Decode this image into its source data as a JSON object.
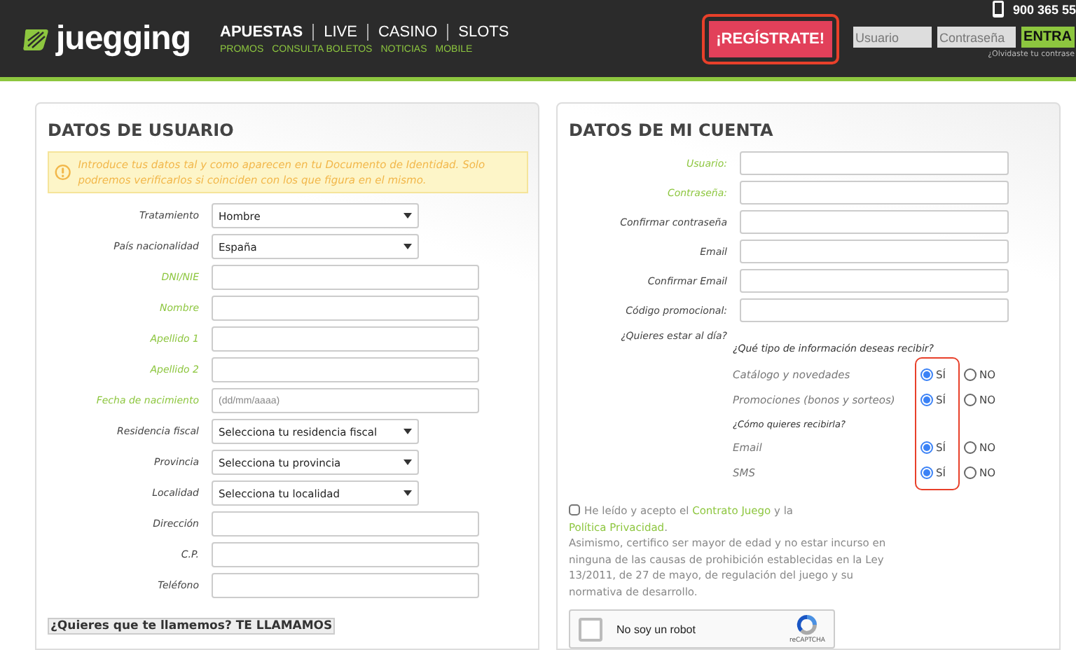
{
  "header": {
    "logo": "juegging",
    "nav_main": [
      {
        "label": "APUESTAS",
        "selected": true
      },
      {
        "label": "LIVE",
        "selected": false
      },
      {
        "label": "CASINO",
        "selected": false
      },
      {
        "label": "SLOTS",
        "selected": false
      }
    ],
    "nav_sub": [
      "PROMOS",
      "CONSULTA BOLETOS",
      "NOTICIAS",
      "MOBILE"
    ],
    "phone": "900 365 55",
    "register_button": {
      "label": "¡REGÍSTRATE!",
      "highlighted": true
    },
    "login": {
      "username_placeholder": "Usuario",
      "password_placeholder": "Contraseña",
      "submit": "ENTRA",
      "forgot": "¿Olvidaste tu contrase"
    }
  },
  "user_panel": {
    "title": "DATOS DE USUARIO",
    "notice": "Introduce tus datos tal y como aparecen en tu Documento de Identidad. Solo podremos verificarlos si coinciden con los que figura en el mismo.",
    "fields": [
      {
        "label": "Tratamiento",
        "kind": "select",
        "value": "Hombre",
        "required": false
      },
      {
        "label": "País nacionalidad",
        "kind": "select",
        "value": "España",
        "required": false
      },
      {
        "label": "DNI/NIE",
        "kind": "input",
        "required": true
      },
      {
        "label": "Nombre",
        "kind": "input",
        "required": true
      },
      {
        "label": "Apellido 1",
        "kind": "input",
        "required": true
      },
      {
        "label": "Apellido 2",
        "kind": "input",
        "required": true
      },
      {
        "label": "Fecha de nacimiento",
        "kind": "input",
        "placeholder": "(dd/mm/aaaa)",
        "required": true
      },
      {
        "label": "Residencia fiscal",
        "kind": "select",
        "value": "Selecciona tu residencia fiscal",
        "required": false
      },
      {
        "label": "Provincia",
        "kind": "select",
        "value": "Selecciona tu provincia",
        "required": false
      },
      {
        "label": "Localidad",
        "kind": "select",
        "value": "Selecciona tu localidad",
        "required": false
      },
      {
        "label": "Dirección",
        "kind": "input",
        "required": false
      },
      {
        "label": "C.P.",
        "kind": "input",
        "required": false
      },
      {
        "label": "Teléfono",
        "kind": "input",
        "required": false
      }
    ],
    "callback": "¿Quieres que te llamemos? TE LLAMAMOS"
  },
  "account_panel": {
    "title": "DATOS DE MI CUENTA",
    "fields": [
      {
        "label": "Usuario:",
        "required": true
      },
      {
        "label": "Contraseña:",
        "required": true
      },
      {
        "label": "Confirmar contraseña",
        "required": false
      },
      {
        "label": "Email",
        "required": false
      },
      {
        "label": "Confirmar Email",
        "required": false
      },
      {
        "label": "Código promocional:",
        "required": false
      }
    ],
    "preferences": {
      "question": "¿Quieres estar al día?",
      "heading": "¿Qué tipo de información deseas recibir?",
      "highlighted": true,
      "rows": [
        {
          "kind": "option",
          "label": "Catálogo y novedades",
          "choices": [
            {
              "label": "SÍ",
              "selected": true
            },
            {
              "label": "NO",
              "selected": false
            }
          ]
        },
        {
          "kind": "option",
          "label": "Promociones (bonos y sorteos)",
          "choices": [
            {
              "label": "SÍ",
              "selected": true
            },
            {
              "label": "NO",
              "selected": false
            }
          ]
        },
        {
          "kind": "subheading",
          "label": "¿Cómo quieres recibirla?"
        },
        {
          "kind": "option",
          "label": "Email",
          "choices": [
            {
              "label": "SÍ",
              "selected": true
            },
            {
              "label": "NO",
              "selected": false
            }
          ]
        },
        {
          "kind": "option",
          "label": "SMS",
          "choices": [
            {
              "label": "SÍ",
              "selected": true
            },
            {
              "label": "NO",
              "selected": false
            }
          ]
        }
      ]
    },
    "consent": {
      "checked": false,
      "parts": [
        {
          "kind": "text",
          "text": "He leído y acepto el "
        },
        {
          "kind": "link",
          "text": "Contrato Juego"
        },
        {
          "kind": "text",
          "text": " y la "
        },
        {
          "kind": "link",
          "text": "Política Privacidad"
        },
        {
          "kind": "text",
          "text": "."
        }
      ],
      "note": "Asimismo, certifico ser mayor de edad y no estar incurso en ninguna de las causas de prohibición establecidas en la Ley 13/2011, de 27 de mayo, de regulación del juego y su normativa de desarrollo."
    },
    "captcha": {
      "checked": false,
      "label": "No soy un robot",
      "brand": "reCAPTCHA"
    }
  }
}
